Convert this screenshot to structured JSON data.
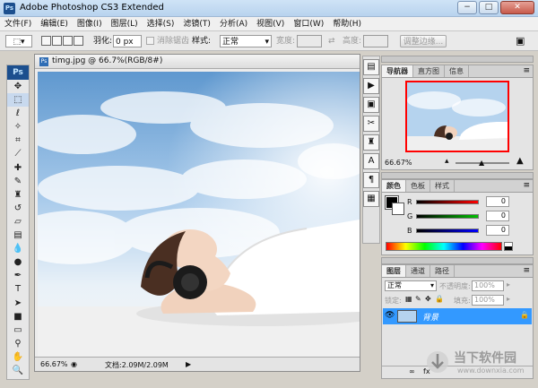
{
  "app": {
    "title": "Adobe Photoshop CS3 Extended",
    "icon_text": "Ps"
  },
  "window_buttons": {
    "minimize": "−",
    "maximize": "□",
    "close": "✕"
  },
  "menu": [
    "文件(F)",
    "编辑(E)",
    "图像(I)",
    "图层(L)",
    "选择(S)",
    "滤镜(T)",
    "分析(A)",
    "视图(V)",
    "窗口(W)",
    "帮助(H)"
  ],
  "options": {
    "feather_label": "羽化:",
    "feather_value": "0 px",
    "antialias_label": "消除锯齿",
    "style_label": "样式:",
    "style_value": "正常",
    "width_label": "宽度:",
    "height_label": "高度:",
    "refine_edge": "调整边缘..."
  },
  "document": {
    "tab_icon": "Ps",
    "tab_title": "timg.jpg @ 66.7%(RGB/8#)",
    "zoom": "66.67%",
    "doc_size": "文档:2.09M/2.09M"
  },
  "tools": [
    "move-icon",
    "marquee-icon",
    "lasso-icon",
    "magic-wand-icon",
    "crop-icon",
    "slice-icon",
    "healing-icon",
    "brush-icon",
    "clone-stamp-icon",
    "history-brush-icon",
    "eraser-icon",
    "gradient-icon",
    "blur-icon",
    "dodge-icon",
    "pen-icon",
    "type-icon",
    "path-select-icon",
    "shape-icon",
    "notes-icon",
    "eyedropper-icon",
    "hand-icon",
    "zoom-icon"
  ],
  "navigator_panel": {
    "tabs": [
      "导航器",
      "直方图",
      "信息"
    ],
    "zoom": "66.67%"
  },
  "color_panel": {
    "tabs": [
      "颜色",
      "色板",
      "样式"
    ],
    "channels": [
      {
        "label": "R",
        "value": "0"
      },
      {
        "label": "G",
        "value": "0"
      },
      {
        "label": "B",
        "value": "0"
      }
    ]
  },
  "layers_panel": {
    "tabs": [
      "图层",
      "通道",
      "路径"
    ],
    "blend_mode": "正常",
    "opacity_label": "不透明度:",
    "opacity_value": "100%",
    "lock_label": "锁定:",
    "fill_label": "填充:",
    "fill_value": "100%",
    "layer_name": "背景"
  },
  "watermark": {
    "text": "当下软件园",
    "url": "www.downxia.com"
  },
  "colors": {
    "accent_blue": "#3399ff",
    "title_gradient": "#cfe3f6",
    "navigator_frame": "#ff0000"
  }
}
